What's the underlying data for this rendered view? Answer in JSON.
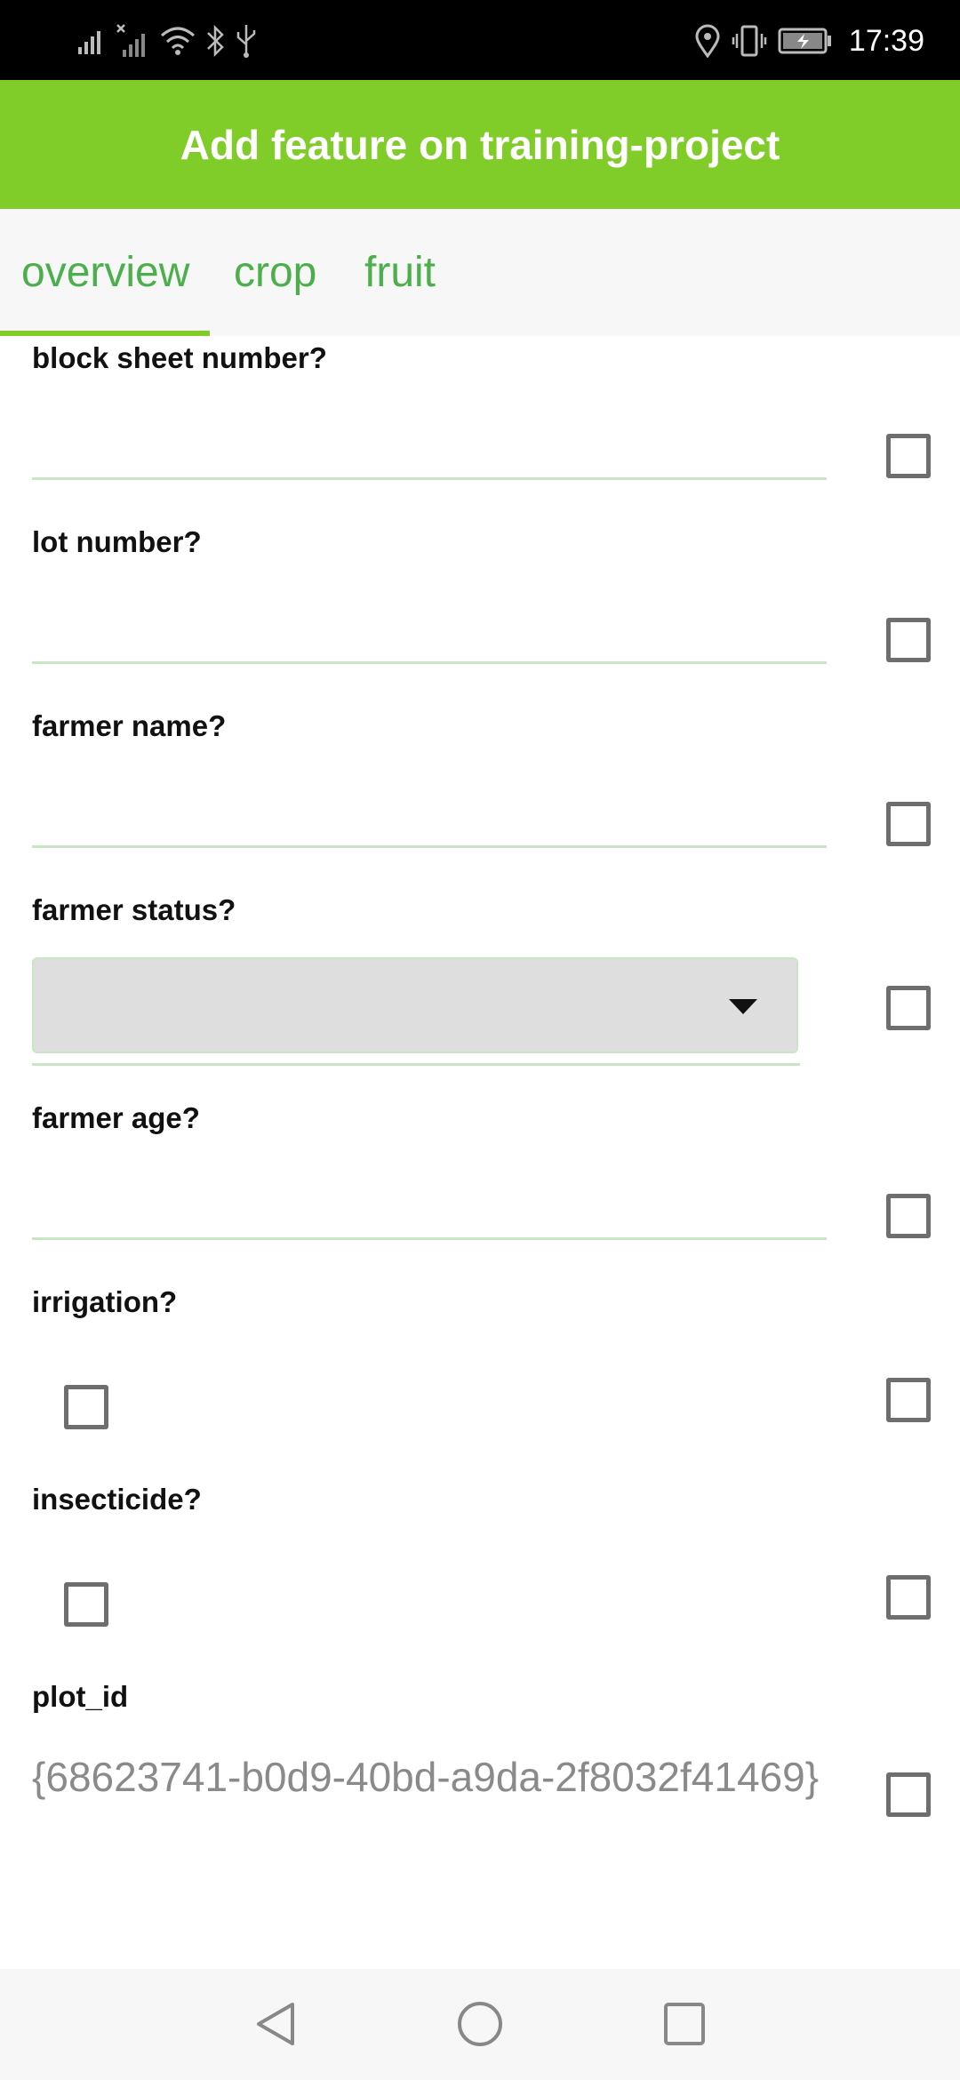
{
  "status_bar": {
    "time": "17:39",
    "left_icons": [
      "signal-icon",
      "no-signal-icon",
      "wifi-icon",
      "bluetooth-icon",
      "usb-icon"
    ],
    "right_icons": [
      "location-icon",
      "vibrate-icon",
      "battery-charging-icon"
    ]
  },
  "app_bar": {
    "title": "Add feature on training-project",
    "background": "#80cc28"
  },
  "tabs": [
    {
      "label": "overview",
      "selected": true
    },
    {
      "label": "crop",
      "selected": false
    },
    {
      "label": "fruit",
      "selected": false
    }
  ],
  "form": {
    "block_sheet_number": {
      "label": "block sheet number?",
      "value": ""
    },
    "lot_number": {
      "label": "lot number?",
      "value": ""
    },
    "farmer_name": {
      "label": "farmer name?",
      "value": ""
    },
    "farmer_status": {
      "label": "farmer status?",
      "selected": ""
    },
    "farmer_age": {
      "label": "farmer age?",
      "value": ""
    },
    "irrigation": {
      "label": "irrigation?",
      "checked": false
    },
    "insecticide": {
      "label": "insecticide?",
      "checked": false
    },
    "plot_id": {
      "label": "plot_id",
      "value": "{68623741-b0d9-40bd-a9da-2f8032f41469}"
    }
  },
  "nav_bar": {
    "icons": [
      "back-icon",
      "home-icon",
      "recents-icon"
    ]
  },
  "colors": {
    "accent": "#80cc28",
    "tab_text": "#4cae4c",
    "underline": "#c9e6c4"
  }
}
